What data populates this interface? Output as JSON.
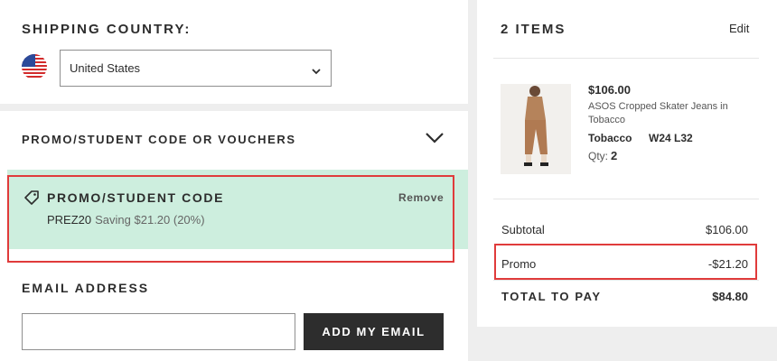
{
  "shipping": {
    "heading": "SHIPPING COUNTRY:",
    "country": "United States",
    "flag_icon": "us-flag-icon"
  },
  "promo": {
    "section_heading": "PROMO/STUDENT CODE OR VOUCHERS",
    "applied_title": "PROMO/STUDENT CODE",
    "code": "PREZ20",
    "saving_text": "Saving $21.20 (20%)",
    "remove_label": "Remove",
    "box_color": "#cdeede",
    "highlight_color": "#e03b3b"
  },
  "email": {
    "heading": "EMAIL ADDRESS",
    "input_value": "",
    "button_label": "ADD MY EMAIL"
  },
  "bag": {
    "title": "2 ITEMS",
    "edit_label": "Edit",
    "item": {
      "price": "$106.00",
      "name": "ASOS Cropped Skater Jeans in Tobacco",
      "color": "Tobacco",
      "size": "W24 L32",
      "qty_label": "Qty:",
      "qty_value": "2"
    },
    "subtotal_label": "Subtotal",
    "subtotal_value": "$106.00",
    "promo_label": "Promo",
    "promo_value": "-$21.20",
    "total_label": "TOTAL TO PAY",
    "total_value": "$84.80"
  }
}
